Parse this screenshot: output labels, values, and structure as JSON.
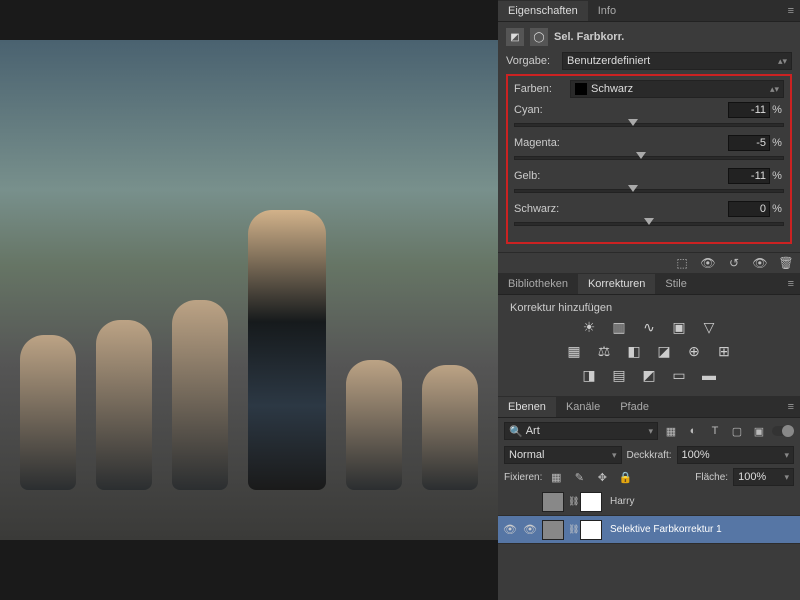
{
  "properties": {
    "tabs": [
      "Eigenschaften",
      "Info"
    ],
    "activeTab": 0,
    "adjustmentTitle": "Sel. Farbkorr.",
    "presetLabel": "Vorgabe:",
    "presetValue": "Benutzerdefiniert",
    "colorsLabel": "Farben:",
    "colorsValue": "Schwarz",
    "sliders": [
      {
        "label": "Cyan:",
        "value": "-11",
        "pos": 44
      },
      {
        "label": "Magenta:",
        "value": "-5",
        "pos": 47
      },
      {
        "label": "Gelb:",
        "value": "-11",
        "pos": 44
      },
      {
        "label": "Schwarz:",
        "value": "0",
        "pos": 50
      }
    ],
    "percent": "%"
  },
  "corrections": {
    "tabs": [
      "Bibliotheken",
      "Korrekturen",
      "Stile"
    ],
    "activeTab": 1,
    "addLabel": "Korrektur hinzufügen"
  },
  "layers": {
    "tabs": [
      "Ebenen",
      "Kanäle",
      "Pfade"
    ],
    "activeTab": 0,
    "searchPlaceholder": "Art",
    "blendLabel": "Normal",
    "opacityLabel": "Deckkraft:",
    "opacityValue": "100%",
    "lockLabel": "Fixieren:",
    "fillLabel": "Fläche:",
    "fillValue": "100%",
    "items": [
      {
        "name": "Harry",
        "visible": false,
        "selected": false,
        "hasMask": true
      },
      {
        "name": "Selektive Farbkorrektur 1",
        "visible": true,
        "selected": true,
        "hasMask": true
      }
    ]
  }
}
